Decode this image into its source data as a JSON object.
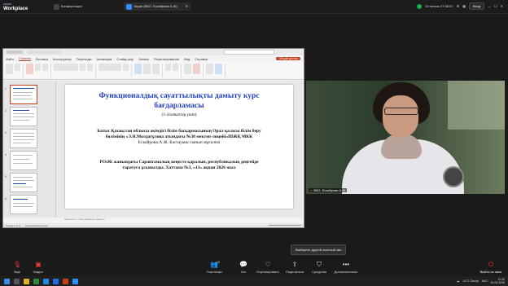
{
  "zoom": {
    "logo_top": "zoom",
    "logo_bottom": "Workplace",
    "tabs": [
      {
        "label": "Конференции"
      },
      {
        "label": "Экран (ВКО. Ескайрова А.Ж)"
      }
    ],
    "status": "Осталось 07:58:07",
    "signin_button": "Вход"
  },
  "ppt": {
    "title_items": [
      "Файл",
      "Главная",
      "Вставка",
      "Конструктор",
      "Переходы",
      "Анимация",
      "Слайд-шоу",
      "Запись",
      "Рецензирование",
      "Вид",
      "Справка"
    ],
    "active_menu": "Главная",
    "share_button": "Общий доступ",
    "slide_numbers": [
      "1",
      "2",
      "3",
      "4",
      "5",
      "6"
    ],
    "notes_placeholder": "Щелкните, чтобы добавить заметки",
    "status_left": "Слайд 1 из 6",
    "status_lang": "русский (Казахстан)"
  },
  "slide": {
    "title_line1": "Функционалдық сауаттылықты дамыту курс",
    "title_line2": "бағдарламасы",
    "subtitle": "(1-2сыныптар үшін)",
    "body1_line1": "Батыс Қазақстан облысы әкімдігі білім басқармасының Орал қаласы білім беру",
    "body1_line2": "бөлімінің «Э.Н.Молдағұлова атындағы №38 мектеп-лицейі»ШЖҚ МКК",
    "body1_line3": "Ескайрова.А.Ж. Бастауыш сынып мұғалімі",
    "body2_line1": "РОӘК жанындағы Сараптамалық кеңесте қаралып, республикалық деңгейде",
    "body2_line2": "таратуға ұсынылды.    Хаттама №3, «13» ақпан 2026 жыл"
  },
  "video": {
    "name": "ВКО. Ескайрова А.Ж"
  },
  "tooltip": "Выберите другой оконный зал",
  "toolbar": {
    "audio": "Звук",
    "video": "Видео",
    "participants": "Участники",
    "participants_count": "15",
    "chat": "Чат",
    "reactions": "Отреагировать",
    "share": "Поделиться",
    "host_tools": "Средства",
    "more": "Дополнительно",
    "leave": "Выйти из зала"
  },
  "taskbar": {
    "weather": "14°C Cloudy",
    "lang": "КАЗ",
    "time": "11:34",
    "date": "20.04.2026"
  },
  "colors": {
    "accent_red": "#c43e1c",
    "slide_title_blue": "#1f3fbf",
    "leave_red": "#e53935"
  }
}
